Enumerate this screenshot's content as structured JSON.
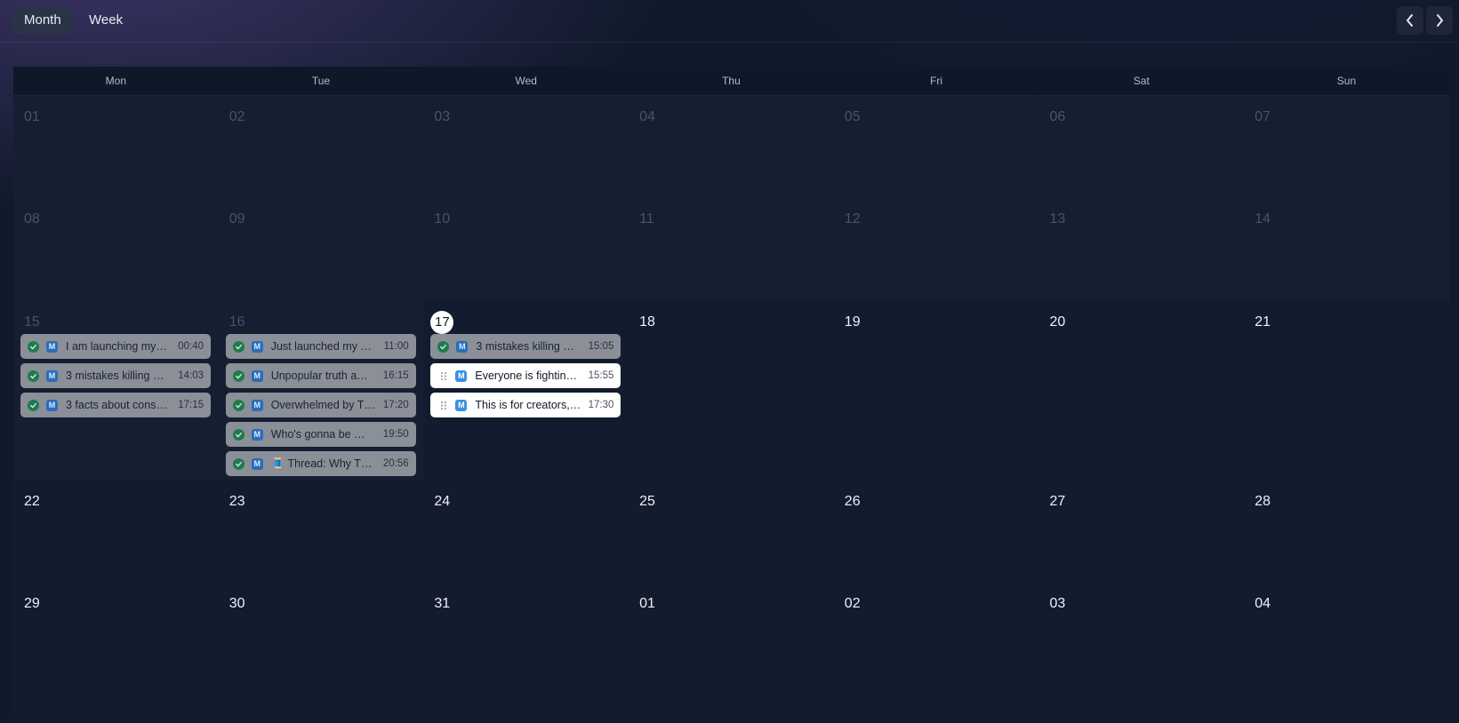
{
  "toolbar": {
    "views": [
      {
        "label": "Month",
        "active": true
      },
      {
        "label": "Week",
        "active": false
      }
    ],
    "prev_icon": "chevron-left-icon",
    "next_icon": "chevron-right-icon"
  },
  "weekdays": [
    "Mon",
    "Tue",
    "Wed",
    "Thu",
    "Fri",
    "Sat",
    "Sun"
  ],
  "today": "17",
  "weeks": [
    [
      "01",
      "02",
      "03",
      "04",
      "05",
      "06",
      "07"
    ],
    [
      "08",
      "09",
      "10",
      "11",
      "12",
      "13",
      "14"
    ],
    [
      "15",
      "16",
      "17",
      "18",
      "19",
      "20",
      "21"
    ],
    [
      "22",
      "23",
      "24",
      "25",
      "26",
      "27",
      "28"
    ],
    [
      "29",
      "30",
      "31",
      "01",
      "02",
      "03",
      "04"
    ]
  ],
  "dimmed_days": [
    "01",
    "02",
    "03",
    "04",
    "05",
    "06",
    "07",
    "08",
    "09",
    "10",
    "11",
    "12",
    "13",
    "14",
    "15",
    "16"
  ],
  "events": {
    "15": [
      {
        "title": "I am launching my…",
        "time": "00:40",
        "status": "done"
      },
      {
        "title": "3 mistakes killing …",
        "time": "14:03",
        "status": "done"
      },
      {
        "title": "3 facts about cons…",
        "time": "17:15",
        "status": "done"
      }
    ],
    "16": [
      {
        "title": "Just launched my …",
        "time": "11:00",
        "status": "done"
      },
      {
        "title": "Unpopular truth a…",
        "time": "16:15",
        "status": "done"
      },
      {
        "title": "Overwhelmed by T…",
        "time": "17:20",
        "status": "done"
      },
      {
        "title": "Who's gonna be …",
        "time": "19:50",
        "status": "done"
      },
      {
        "title": "🧵 Thread: Why T…",
        "time": "20:56",
        "status": "done"
      }
    ],
    "17": [
      {
        "title": "3 mistakes killing …",
        "time": "15:05",
        "status": "done"
      },
      {
        "title": "Everyone is fightin…",
        "time": "15:55",
        "status": "pending"
      },
      {
        "title": "This is for creators,…",
        "time": "17:30",
        "status": "pending"
      }
    ]
  },
  "event_badge": "M",
  "colors": {
    "background": "#111a2c",
    "done_event": "#8a8f98",
    "pending_event": "#ffffff",
    "check": "#1f7a4f",
    "badge": "#2a6db8"
  }
}
